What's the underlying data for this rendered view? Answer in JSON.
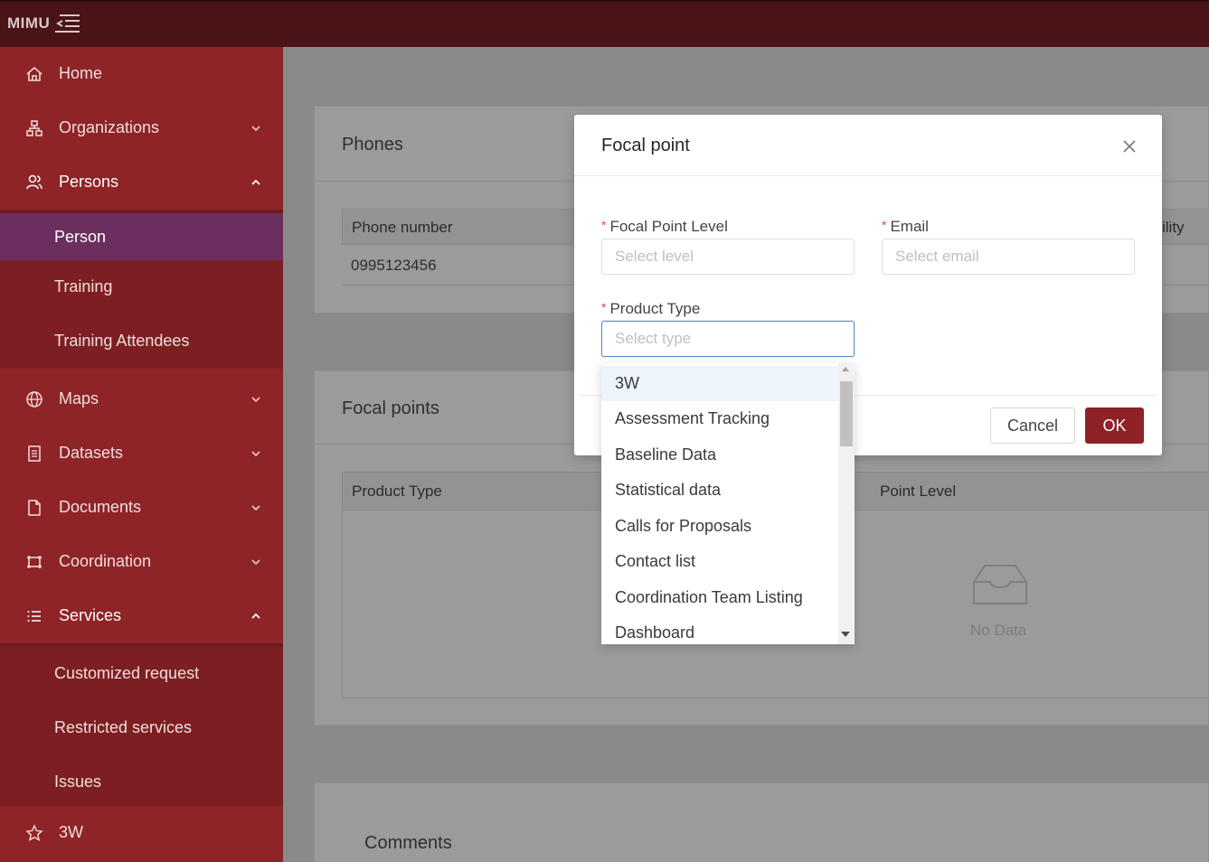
{
  "app": {
    "logo": "MIMU"
  },
  "sidebar": {
    "items": [
      {
        "label": "Home",
        "icon": "home-icon"
      },
      {
        "label": "Organizations",
        "icon": "organization-icon"
      },
      {
        "label": "Persons",
        "icon": "persons-icon"
      },
      {
        "label": "Person"
      },
      {
        "label": "Training"
      },
      {
        "label": "Training Attendees"
      },
      {
        "label": "Maps",
        "icon": "globe-icon"
      },
      {
        "label": "Datasets",
        "icon": "dataset-icon"
      },
      {
        "label": "Documents",
        "icon": "document-icon"
      },
      {
        "label": "Coordination",
        "icon": "coordination-icon"
      },
      {
        "label": "Services",
        "icon": "list-icon"
      },
      {
        "label": "Customized request"
      },
      {
        "label": "Restricted services"
      },
      {
        "label": "Issues"
      },
      {
        "label": "3W",
        "icon": "star-icon"
      }
    ]
  },
  "phones_card": {
    "title": "Phones",
    "col_phone": "Phone number",
    "phone_value": "0995123456",
    "col_partial": "ility"
  },
  "focal_card": {
    "title": "Focal points",
    "col_product": "Product Type",
    "col_level_partial": "Point Level",
    "empty_text": "No Data"
  },
  "comments_card": {
    "title": "Comments"
  },
  "modal": {
    "title": "Focal point",
    "level_label": "Focal Point Level",
    "level_placeholder": "Select level",
    "email_label": "Email",
    "email_placeholder": "Select email",
    "product_label": "Product Type",
    "product_placeholder": "Select type",
    "required_mark": "*",
    "cancel_label": "Cancel",
    "ok_label": "OK"
  },
  "dropdown": {
    "options": [
      "3W",
      "Assessment Tracking",
      "Baseline Data",
      "Statistical data",
      "Calls for Proposals",
      "Contact list",
      "Coordination Team Listing",
      "Dashboard"
    ]
  },
  "colors": {
    "topbar": "#4a1416",
    "sidebar": "#8e2427",
    "active_item": "#6c2e5e",
    "primary_button": "#8e2226"
  }
}
